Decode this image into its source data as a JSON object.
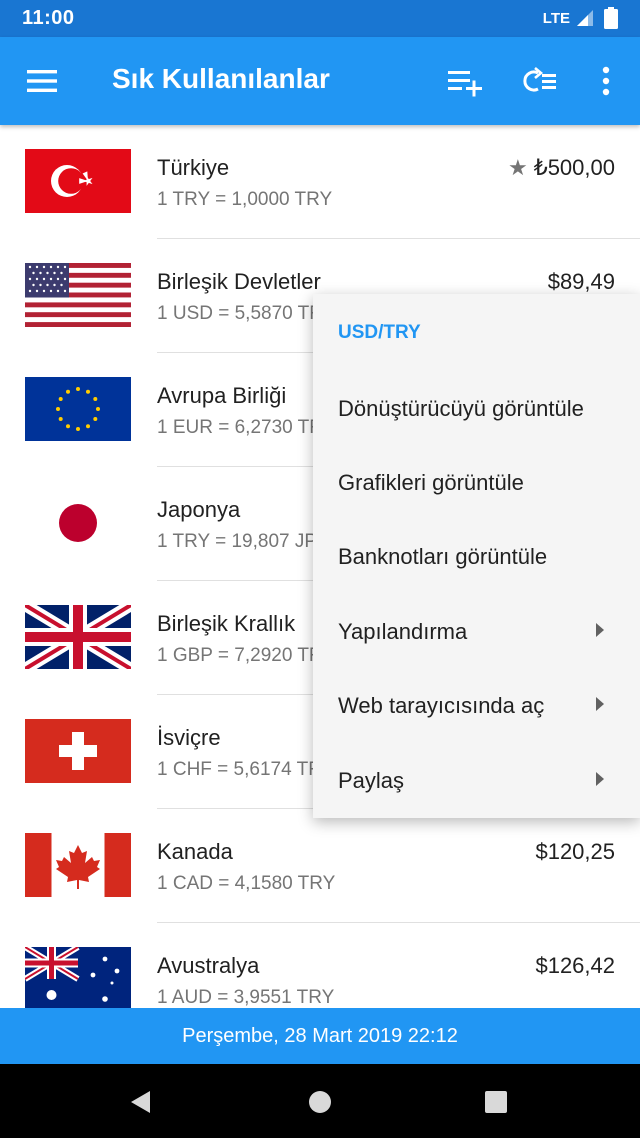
{
  "status_bar": {
    "time": "11:00",
    "network": "LTE"
  },
  "app_bar": {
    "title": "Sık Kullanılanlar",
    "icons": [
      "menu-icon",
      "add-list-icon",
      "reorder-icon",
      "more-vert-icon"
    ]
  },
  "rows": [
    {
      "country": "Türkiye",
      "rate": "1 TRY = 1,0000 TRY",
      "amount": "₺500,00",
      "starred": true,
      "flag": "turkey"
    },
    {
      "country": "Birleşik Devletler",
      "rate": "1 USD = 5,5870 TRY",
      "amount": "$89,49",
      "flag": "usa"
    },
    {
      "country": "Avrupa Birliği",
      "rate": "1 EUR = 6,2730 TRY",
      "amount": "",
      "flag": "eu"
    },
    {
      "country": "Japonya",
      "rate": "1 TRY = 19,807 JPY",
      "amount": "",
      "flag": "japan"
    },
    {
      "country": "Birleşik Krallık",
      "rate": "1 GBP = 7,2920 TRY",
      "amount": "",
      "flag": "uk"
    },
    {
      "country": "İsviçre",
      "rate": "1 CHF = 5,6174 TRY",
      "amount": "",
      "flag": "switzerland"
    },
    {
      "country": "Kanada",
      "rate": "1 CAD = 4,1580 TRY",
      "amount": "$120,25",
      "flag": "canada"
    },
    {
      "country": "Avustralya",
      "rate": "1 AUD = 3,9551 TRY",
      "amount": "$126,42",
      "flag": "australia"
    }
  ],
  "popup": {
    "title": "USD/TRY",
    "items": [
      {
        "label": "Dönüştürücüyü görüntüle",
        "submenu": false
      },
      {
        "label": "Grafikleri görüntüle",
        "submenu": false
      },
      {
        "label": "Banknotları görüntüle",
        "submenu": false
      },
      {
        "label": "Yapılandırma",
        "submenu": true
      },
      {
        "label": "Web tarayıcısında aç",
        "submenu": true
      },
      {
        "label": "Paylaş",
        "submenu": true
      }
    ]
  },
  "footer": {
    "date": "Perşembe, 28 Mart 2019 22:12"
  },
  "colors": {
    "primary": "#2196f3",
    "status_bar": "#1976d2",
    "popup_title": "#2196f3"
  }
}
